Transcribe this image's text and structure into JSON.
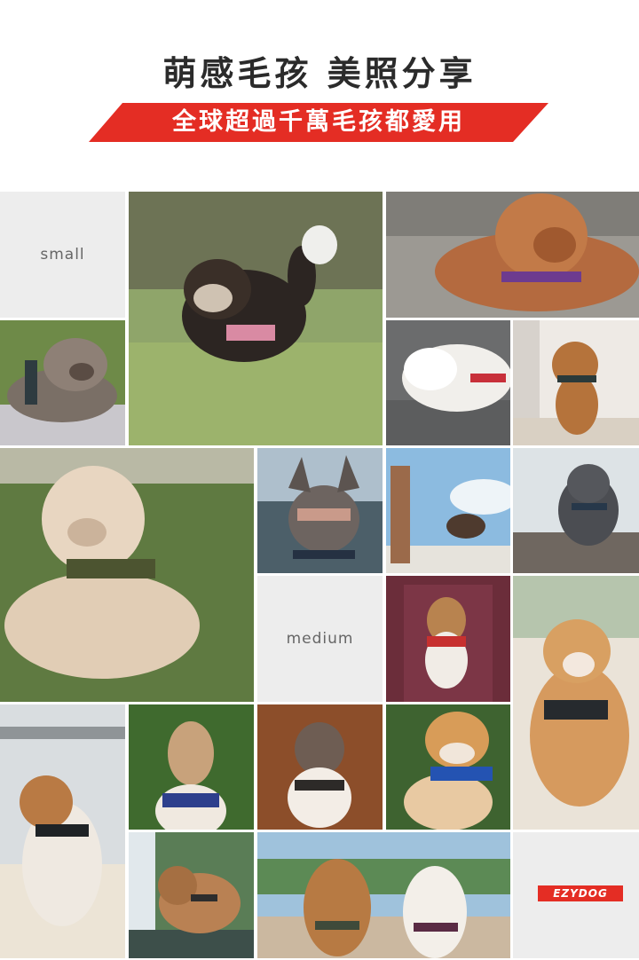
{
  "header": {
    "title": "萌感毛孩 美照分享",
    "banner": "全球超過千萬毛孩都愛用"
  },
  "labels": {
    "small": "small",
    "medium": "medium"
  },
  "logo": {
    "text": "EZYDOG",
    "color": "#e42d24"
  },
  "colors": {
    "banner_red": "#e42d24",
    "tile_grey": "#ededed"
  }
}
